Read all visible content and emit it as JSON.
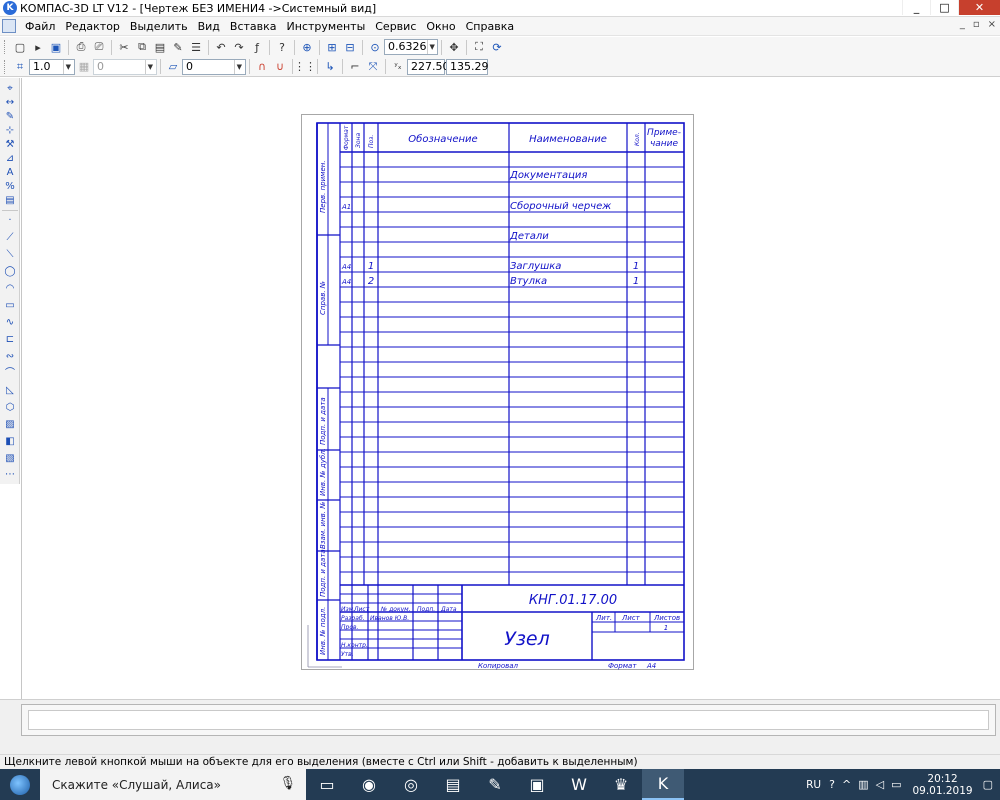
{
  "window": {
    "title": "КОМПАС-3D LT V12 - [Чертеж БЕЗ ИМЕНИ4 ->Системный вид]",
    "minimize": "_",
    "maximize": "□",
    "close": "✕"
  },
  "menu": {
    "items": [
      "Файл",
      "Редактор",
      "Выделить",
      "Вид",
      "Вставка",
      "Инструменты",
      "Сервис",
      "Окно",
      "Справка"
    ],
    "mdi_controls": [
      "_",
      "▫",
      "×"
    ]
  },
  "toolbar1": {
    "zoom_value": "0.6326"
  },
  "toolbar2": {
    "scale_value": "1.0",
    "layer_value": "0",
    "style_value": "0",
    "coord_x": "227.50",
    "coord_y": "135.29"
  },
  "spec": {
    "headers": {
      "format": "Формат",
      "zone": "Зона",
      "pos": "Поз.",
      "designation": "Обозначение",
      "name": "Наименование",
      "qty": "Кол.",
      "note_line1": "Приме-",
      "note_line2": "чание"
    },
    "side_labels": [
      "Перв. примен.",
      "Справ. №",
      "Подп. и дата",
      "Инв. № дубл.",
      "Взам. инв. №",
      "Подп. и дата",
      "Инв. № подл."
    ],
    "rows": [
      {
        "fmt": "",
        "pos": "",
        "name": "Документация",
        "qty": ""
      },
      {
        "fmt": "А1",
        "pos": "",
        "name": "Сборочный черчеж",
        "qty": ""
      },
      {
        "fmt": "",
        "pos": "",
        "name": "Детали",
        "qty": ""
      },
      {
        "fmt": "А4",
        "pos": "1",
        "name": "Заглушка",
        "qty": "1"
      },
      {
        "fmt": "А4",
        "pos": "2",
        "name": "Втулка",
        "qty": "1"
      }
    ],
    "stamp": {
      "code": "КНГ.01.17.00",
      "title": "Узел",
      "col_izm": "Изм.",
      "col_list": "Лист",
      "col_doc": "№ докум.",
      "col_sign": "Подп.",
      "col_date": "Дата",
      "razrab_label": "Разраб.",
      "razrab_name": "Иванов Ю.В.",
      "prov_label": "Пров.",
      "nkontr_label": "Н.контр.",
      "utv_label": "Утв.",
      "lit_label": "Лит.",
      "sheet_label": "Лист",
      "sheets_label": "Листов",
      "sheets_value": "1",
      "copied": "Копировал",
      "format_label": "Формат",
      "format_value": "А4"
    }
  },
  "status": {
    "hint": "Щелкните левой кнопкой мыши на объекте для его выделения (вместе с Ctrl или Shift - добавить к выделенным)"
  },
  "taskbar": {
    "search_placeholder": "Скажите «Слушай, Алиса»",
    "lang": "RU",
    "time": "20:12",
    "date": "09.01.2019"
  }
}
